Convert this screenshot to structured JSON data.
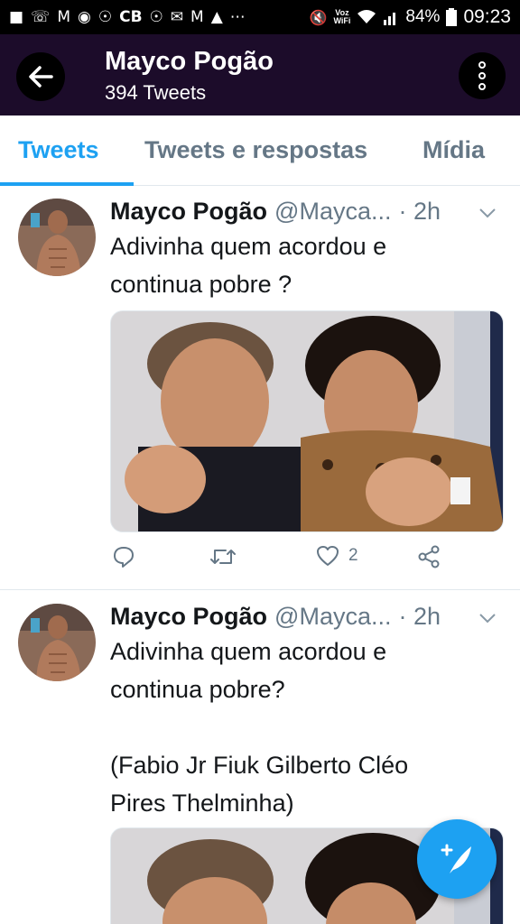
{
  "status_bar": {
    "left_icons": [
      "message-icon",
      "whatsapp-icon",
      "gmail-icon",
      "voicemail-icon",
      "chrome-icon",
      "cb-icon",
      "chrome-icon",
      "mail-icon",
      "gmail-icon",
      "warning-icon",
      "more-notifications-icon"
    ],
    "cb_label": "CB",
    "voz_label_1": "Voz",
    "voz_label_2": "WiFi",
    "battery": "84%",
    "time": "09:23"
  },
  "header": {
    "name": "Mayco Pogão",
    "tweet_count": "394 Tweets"
  },
  "tabs": [
    {
      "label": "Tweets",
      "active": true
    },
    {
      "label": "Tweets e respostas",
      "active": false
    },
    {
      "label": "Mídia",
      "active": false
    }
  ],
  "tweets": [
    {
      "name": "Mayco Pogão",
      "handle": "@Mayca...",
      "time": "· 2h",
      "text": "Adivinha quem acordou e\ncontinua pobre ?",
      "likes": "2"
    },
    {
      "name": "Mayco Pogão",
      "handle": "@Mayca...",
      "time": "· 2h",
      "text": "Adivinha quem acordou e\ncontinua pobre?\n\n(Fabio Jr Fiuk Gilberto Cléo\nPires Thelminha)"
    }
  ],
  "colors": {
    "accent": "#1da1f2",
    "header_bg": "#1c0c2a",
    "muted": "#657786"
  }
}
